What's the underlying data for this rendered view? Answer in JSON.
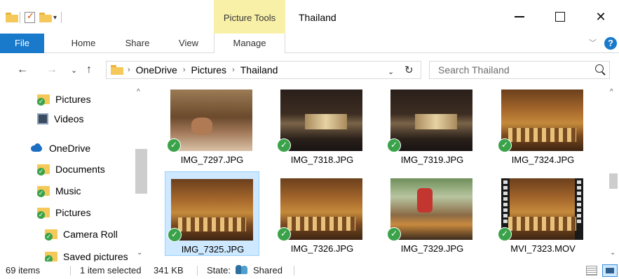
{
  "window": {
    "title": "Thailand",
    "context_tab_group": "Picture Tools"
  },
  "ribbon": {
    "tabs": [
      "File",
      "Home",
      "Share",
      "View",
      "Manage"
    ],
    "help": "?"
  },
  "address": {
    "breadcrumb": [
      "OneDrive",
      "Pictures",
      "Thailand"
    ],
    "search_placeholder": "Search Thailand"
  },
  "sidebar": {
    "items": [
      {
        "label": "Pictures",
        "icon": "quick-access-folder-icon"
      },
      {
        "label": "Videos",
        "icon": "videos-icon"
      },
      {
        "label": "OneDrive",
        "icon": "onedrive-cloud-icon"
      },
      {
        "label": "Documents",
        "icon": "onedrive-folder-icon"
      },
      {
        "label": "Music",
        "icon": "onedrive-folder-icon"
      },
      {
        "label": "Pictures",
        "icon": "onedrive-folder-icon"
      },
      {
        "label": "Camera Roll",
        "icon": "onedrive-folder-icon"
      },
      {
        "label": "Saved pictures",
        "icon": "onedrive-folder-icon"
      }
    ]
  },
  "files": [
    {
      "name": "IMG_7297.JPG",
      "thumb": "bed",
      "selected": false
    },
    {
      "name": "IMG_7318.JPG",
      "thumb": "stage",
      "selected": false
    },
    {
      "name": "IMG_7319.JPG",
      "thumb": "stage",
      "selected": false
    },
    {
      "name": "IMG_7324.JPG",
      "thumb": "temple",
      "selected": false
    },
    {
      "name": "IMG_7325.JPG",
      "thumb": "temple",
      "selected": true
    },
    {
      "name": "IMG_7326.JPG",
      "thumb": "temple",
      "selected": false
    },
    {
      "name": "IMG_7329.JPG",
      "thumb": "tiger",
      "selected": false
    },
    {
      "name": "MVI_7323.MOV",
      "thumb": "video",
      "selected": false
    }
  ],
  "status": {
    "item_count": "69 items",
    "selection": "1 item selected",
    "size": "341 KB",
    "state_label": "State:",
    "state_value": "Shared"
  },
  "colors": {
    "file_tab": "#1979ca",
    "context_tab": "#f9f0a8",
    "selection": "#cde8ff",
    "sync_ok": "#3aa34a"
  }
}
